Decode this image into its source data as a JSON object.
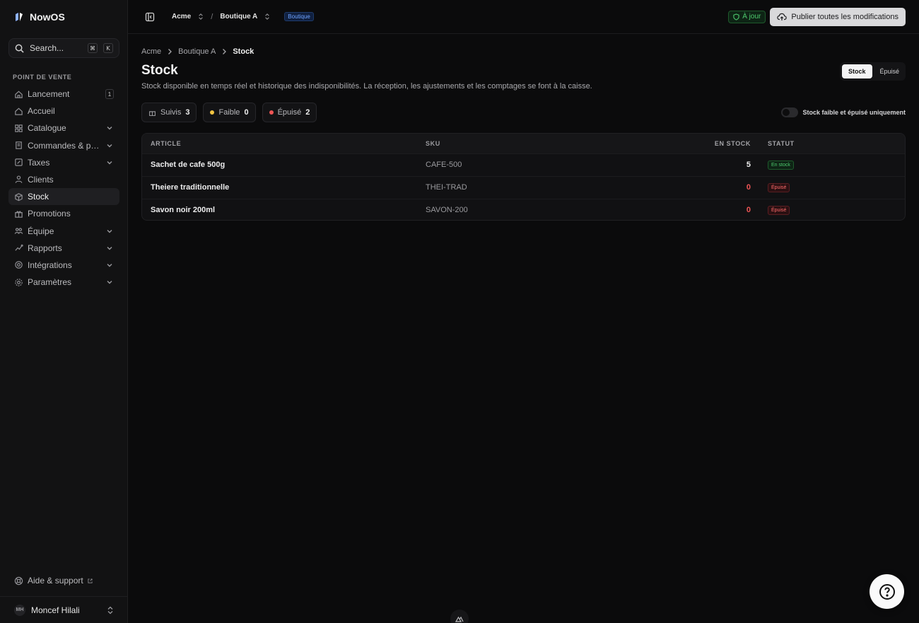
{
  "app": {
    "name": "NowOS"
  },
  "search": {
    "placeholder": "Search...",
    "kbd1": "⌘",
    "kbd2": "K"
  },
  "sidebar": {
    "section_label": "POINT DE VENTE",
    "items": [
      {
        "label": "Lancement",
        "icon": "home-icon",
        "badge": "1"
      },
      {
        "label": "Accueil",
        "icon": "home-icon"
      },
      {
        "label": "Catalogue",
        "icon": "grid-icon",
        "expandable": true
      },
      {
        "label": "Commandes & paiements",
        "icon": "receipt-icon",
        "expandable": true
      },
      {
        "label": "Taxes",
        "icon": "percent-icon",
        "expandable": true
      },
      {
        "label": "Clients",
        "icon": "users-icon"
      },
      {
        "label": "Stock",
        "icon": "box-icon",
        "active": true
      },
      {
        "label": "Promotions",
        "icon": "gift-icon"
      },
      {
        "label": "Équipe",
        "icon": "team-icon",
        "expandable": true
      },
      {
        "label": "Rapports",
        "icon": "chart-icon",
        "expandable": true
      },
      {
        "label": "Intégrations",
        "icon": "plug-icon",
        "expandable": true
      },
      {
        "label": "Paramètres",
        "icon": "gear-icon",
        "expandable": true
      }
    ],
    "help_label": "Aide & support",
    "user": {
      "initials": "MH",
      "name": "Moncef Hilali"
    }
  },
  "topbar": {
    "org": "Acme",
    "separator": "/",
    "store": "Boutique A",
    "store_tag": "Boutique",
    "status": "À jour",
    "publish_label": "Publier toutes les modifications"
  },
  "breadcrumb": [
    "Acme",
    "Boutique A",
    "Stock"
  ],
  "page": {
    "title": "Stock",
    "subtitle": "Stock disponible en temps réel et historique des indisponibilités. La réception, les ajustements et les comptages se font à la caisse.",
    "view_tabs": [
      {
        "label": "Stock",
        "active": true
      },
      {
        "label": "Épuisé",
        "active": false
      }
    ]
  },
  "summary": {
    "tracked": {
      "label": "Suivis",
      "count": "3"
    },
    "low": {
      "label": "Faible",
      "count": "0",
      "color": "#f5c542"
    },
    "out": {
      "label": "Épuisé",
      "count": "2",
      "color": "#ef5555"
    }
  },
  "filter": {
    "label": "Stock faible et épuisé uniquement",
    "on": false
  },
  "table": {
    "headers": {
      "article": "ARTICLE",
      "sku": "SKU",
      "qty": "EN STOCK",
      "status": "STATUT"
    },
    "rows": [
      {
        "article": "Sachet de cafe 500g",
        "sku": "CAFE-500",
        "qty": "5",
        "status": "En stock",
        "state": "ok"
      },
      {
        "article": "Theiere traditionnelle",
        "sku": "THEI-TRAD",
        "qty": "0",
        "status": "Épuisé",
        "state": "out"
      },
      {
        "article": "Savon noir 200ml",
        "sku": "SAVON-200",
        "qty": "0",
        "status": "Épuisé",
        "state": "out"
      }
    ]
  }
}
